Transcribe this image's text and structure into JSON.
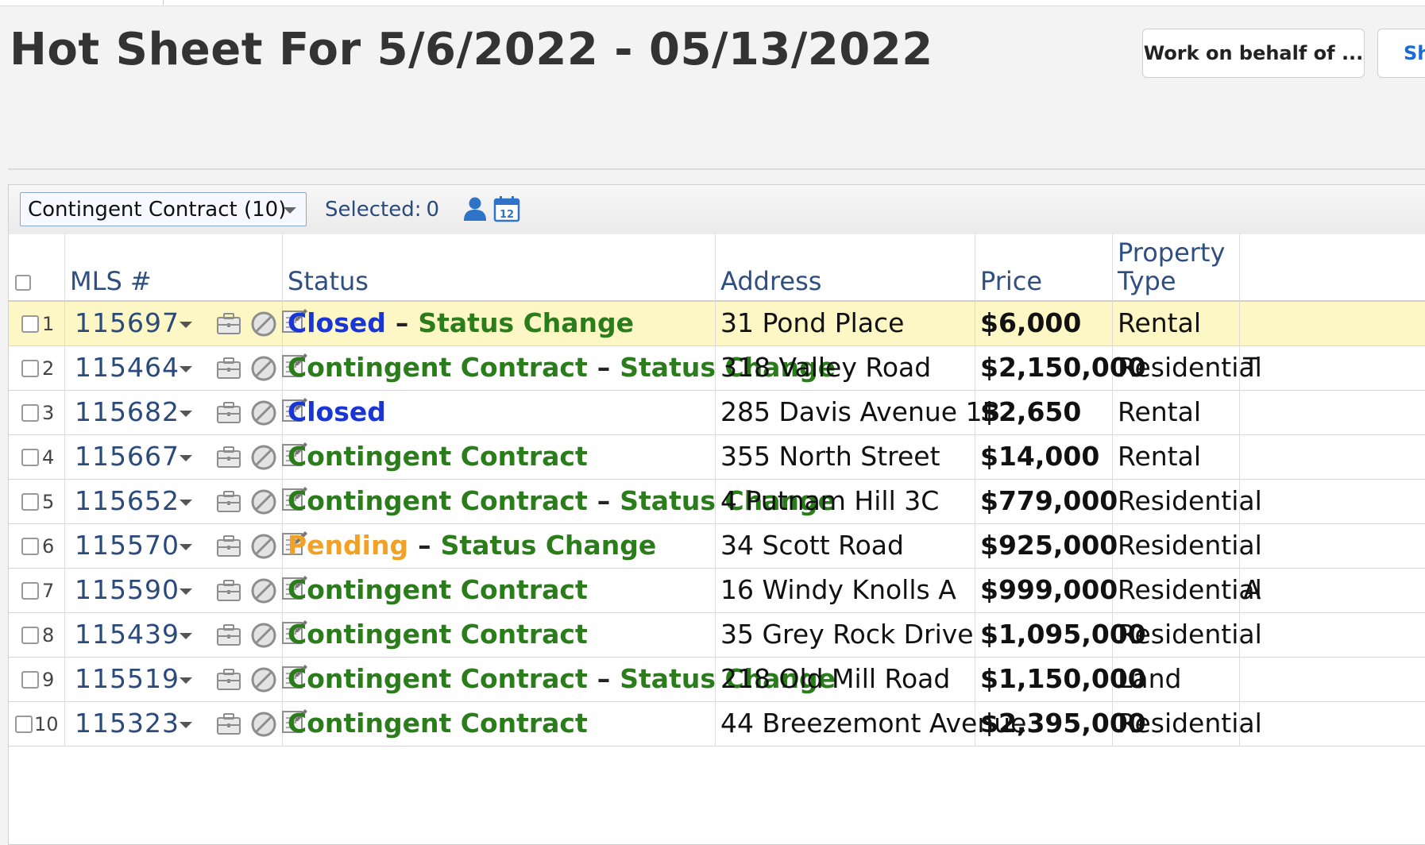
{
  "page": {
    "title": "Hot Sheet For 5/6/2022 - 05/13/2022",
    "buttons": {
      "work_on_behalf": "Work on behalf of ...",
      "share_partial": "Sh"
    }
  },
  "toolbar": {
    "view_selector": "Contingent Contract (10)",
    "selected_label": "Selected:",
    "selected_count": "0",
    "icons": [
      "person-icon",
      "calendar-icon"
    ],
    "calendar_day": "12"
  },
  "columns": {
    "mls": "MLS #",
    "status": "Status",
    "address": "Address",
    "price": "Price",
    "property_type_line1": "Property",
    "property_type_line2": "Type"
  },
  "colors": {
    "closed": "#1a35d6",
    "contingent": "#2b7d1c",
    "pending": "#f1a126",
    "highlight_row": "#fdf7c5",
    "link": "#2b4a7c"
  },
  "rows": [
    {
      "num": "1",
      "mls": "115697",
      "status": "Closed",
      "status_class": "closed",
      "change": "Status Change",
      "address": "31 Pond Place",
      "price": "$6,000",
      "type": "Rental",
      "extra": ""
    },
    {
      "num": "2",
      "mls": "115464",
      "status": "Contingent Contract",
      "status_class": "contingent",
      "change": "Status Change",
      "address": "318 Valley Road",
      "price": "$2,150,000",
      "type": "Residential",
      "extra": "T"
    },
    {
      "num": "3",
      "mls": "115682",
      "status": "Closed",
      "status_class": "closed",
      "change": "",
      "address": "285 Davis Avenue 1B",
      "price": "$2,650",
      "type": "Rental",
      "extra": ""
    },
    {
      "num": "4",
      "mls": "115667",
      "status": "Contingent Contract",
      "status_class": "contingent",
      "change": "",
      "address": "355 North Street",
      "price": "$14,000",
      "type": "Rental",
      "extra": ""
    },
    {
      "num": "5",
      "mls": "115652",
      "status": "Contingent Contract",
      "status_class": "contingent",
      "change": "Status Change",
      "address": "4 Putnam Hill 3C",
      "price": "$779,000",
      "type": "Residential",
      "extra": ""
    },
    {
      "num": "6",
      "mls": "115570",
      "status": "Pending",
      "status_class": "pending",
      "change": "Status Change",
      "address": "34 Scott Road",
      "price": "$925,000",
      "type": "Residential",
      "extra": ""
    },
    {
      "num": "7",
      "mls": "115590",
      "status": "Contingent Contract",
      "status_class": "contingent",
      "change": "",
      "address": "16 Windy Knolls A",
      "price": "$999,000",
      "type": "Residential",
      "extra": "A"
    },
    {
      "num": "8",
      "mls": "115439",
      "status": "Contingent Contract",
      "status_class": "contingent",
      "change": "",
      "address": "35 Grey Rock Drive",
      "price": "$1,095,000",
      "type": "Residential",
      "extra": ""
    },
    {
      "num": "9",
      "mls": "115519",
      "status": "Contingent Contract",
      "status_class": "contingent",
      "change": "Status Change",
      "address": "218 Old Mill Road",
      "price": "$1,150,000",
      "type": "Land",
      "extra": ""
    },
    {
      "num": "10",
      "mls": "115323",
      "status": "Contingent Contract",
      "status_class": "contingent",
      "change": "",
      "address": "44 Breezemont Avenue",
      "price": "$2,395,000",
      "type": "Residential",
      "extra": ""
    }
  ]
}
